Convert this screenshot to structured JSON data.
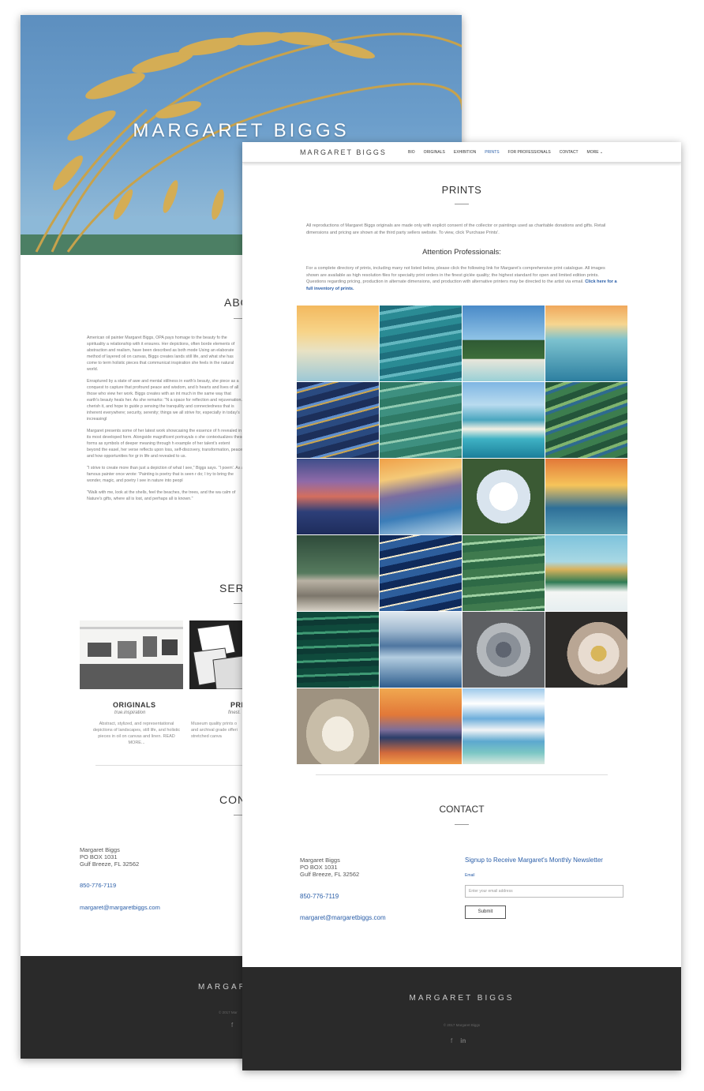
{
  "back_page": {
    "hero_title": "MARGARET BIGGS",
    "about_heading": "ABO",
    "about_paragraphs": [
      "American oil painter Margaret Biggs, OPA pays homage to the beauty fo the spirituality a relationship with it ensures. Her depictions, often borde elements of abstraction and realism, have been described as both mode Using an elaborate method of layered oil on canvas, Biggs creates lands still life, and what she has come to term holistic pieces that communicat inspiration she feels in the natural world.",
      "Enraptured by a state of awe and mental stillness in earth's beauty, she piece as a conquest to capture that profound peace and wisdom, and b hearts and lives of all those who view her work. Biggs creates with an int much in the same way that earth's beauty heals her. As she remarks: \"N a space for reflection and rejuvenation. I cherish it, and hope to guide p sensing the tranquility and connectedness that is inherent everywhere; security, serenity; things we all strive for, especially in today's increasingl",
      "Margaret presents some of her latest work showcasing the essence of h revealed in its most developed form. Alongside magnificent portrayals o she contextualizes these forms as symbols of deeper meaning through h example of her talent's extent beyond the easel, her verse reflects upon loss, self-discovery, transformation, peace, and how opportunities for gr in life and revealed to us.",
      "\"I strive to create more than just a depiction of what I see,\" Biggs says. \"I poem'. As a famous painter once wrote: 'Painting is poetry that is seen r do; I try to bring the wonder, magic, and poetry I see in nature into peopl",
      "\"Walk with me, look at the shells, feel the beaches, the trees, and the wa calm of Nature's gifts, where all is lost, and perhaps all is known.\""
    ],
    "services_heading": "SERV",
    "service_1": {
      "title": "ORIGINALS",
      "tagline": "true.inspiration",
      "desc": "Abstract, stylized, and representational depictions of landscapes, still life, and holistic pieces in oil on canvas and linen. READ MORE..."
    },
    "service_2": {
      "title": "PRI",
      "tagline": "finest.",
      "desc": "Museum quality prints o and archival grade offeri stretched canva"
    },
    "contact_heading": "CONT",
    "address": [
      "Margaret Biggs",
      "PO BOX 1031",
      "Gulf Breeze, FL 32562"
    ],
    "phone": "850-776-7119",
    "email": "margaret@margaretbiggs.com",
    "footer_name": "MARGARET BIGGS",
    "footer_copy": "© 2017 Mar"
  },
  "front_page": {
    "brand": "MARGARET BIGGS",
    "nav": [
      "BIO",
      "ORIGINALS",
      "EXHIBITION",
      "PRINTS",
      "FOR PROFESSIONALS",
      "CONTACT",
      "MORE ⌄"
    ],
    "active_nav": "PRINTS",
    "page_title": "PRINTS",
    "intro_1": "All reproductions of Margaret Biggs originals are made only with explicit consent of the collector or paintings used as charitable donations and gifts. Retail dimensions and pricing are shown at the third party sellers website. To view, click 'Purchase Prints'.",
    "attention_heading": "Attention Professionals:",
    "intro_2": "For a complete directory of prints, including many not listed below, please click the following link for Margaret's comprehensive print catalogue. All images shown are available as high resolution files for specialty print orders in the finest giclée quality; the highest standard for open and limited edition prints. Questions regarding pricing, production in alternate dimensions, and production with alternative printers may be directed to the artist via email.",
    "intro_2_link": "Click here for a full inventory of prints.",
    "contact_heading": "CONTACT",
    "address": [
      "Margaret Biggs",
      "PO BOX 1031",
      "Gulf Breeze, FL 32562"
    ],
    "phone": "850-776-7119",
    "email": "margaret@margaretbiggs.com",
    "newsletter_title": "Signup to Receive Margaret's Monthly Newsletter",
    "newsletter_label": "Email",
    "newsletter_placeholder": "Enter your email address",
    "submit_label": "Submit",
    "footer_name": "MARGARET BIGGS",
    "footer_copy": "© 2017 Margaret Biggs",
    "social_icons": [
      "facebook-icon",
      "linkedin-icon"
    ]
  },
  "gallery_tiles": [
    {
      "subject": "sunset over golden water"
    },
    {
      "subject": "teal abstract waves"
    },
    {
      "subject": "pine trees by shoreline"
    },
    {
      "subject": "sunset wave"
    },
    {
      "subject": "dark blue ripples"
    },
    {
      "subject": "green rippling water"
    },
    {
      "subject": "turquoise shoreline"
    },
    {
      "subject": "green marsh water"
    },
    {
      "subject": "purple sunset"
    },
    {
      "subject": "beach at dusk"
    },
    {
      "subject": "white magnolia"
    },
    {
      "subject": "orange sunset waves"
    },
    {
      "subject": "pebble shoreline"
    },
    {
      "subject": "deep blue ripples"
    },
    {
      "subject": "green waves"
    },
    {
      "subject": "sea oats on dune"
    },
    {
      "subject": "green ocean wave"
    },
    {
      "subject": "blue ocean horizon"
    },
    {
      "subject": "grey succulent"
    },
    {
      "subject": "pale magnolia with gold"
    },
    {
      "subject": "calla lily close-up"
    },
    {
      "subject": "orange sky over island"
    },
    {
      "subject": "clouds over beach"
    }
  ]
}
